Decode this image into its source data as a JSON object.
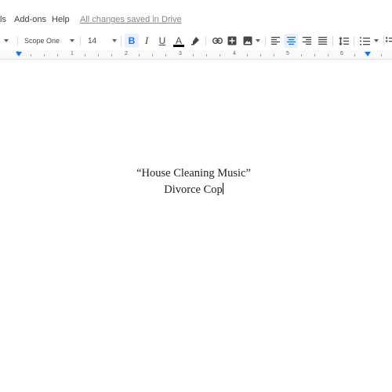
{
  "menubar": {
    "items": [
      "ls",
      "Add-ons",
      "Help"
    ],
    "save_status": "All changes saved in Drive"
  },
  "toolbar": {
    "font_name": "Scope One",
    "font_size": "14",
    "bold_label": "B",
    "italic_label": "I",
    "underline_label": "U",
    "text_color_label": "A",
    "icons": [
      "style-dropdown-icon",
      "chevron-down-icon",
      "bold-icon",
      "italic-icon",
      "underline-icon",
      "text-color-icon",
      "highlight-icon",
      "link-icon",
      "insert-comment-icon",
      "insert-image-icon",
      "align-left-icon",
      "align-center-icon",
      "align-right-icon",
      "justify-icon",
      "line-spacing-icon",
      "numbered-list-icon"
    ],
    "text_color": "#000000",
    "accent": "#1a73e8"
  },
  "ruler": {
    "numbers": [
      "1",
      "1",
      "2",
      "3",
      "4",
      "5",
      "6"
    ]
  },
  "document": {
    "line1": "“House Cleaning Music”",
    "line2": "Divorce Cop"
  }
}
